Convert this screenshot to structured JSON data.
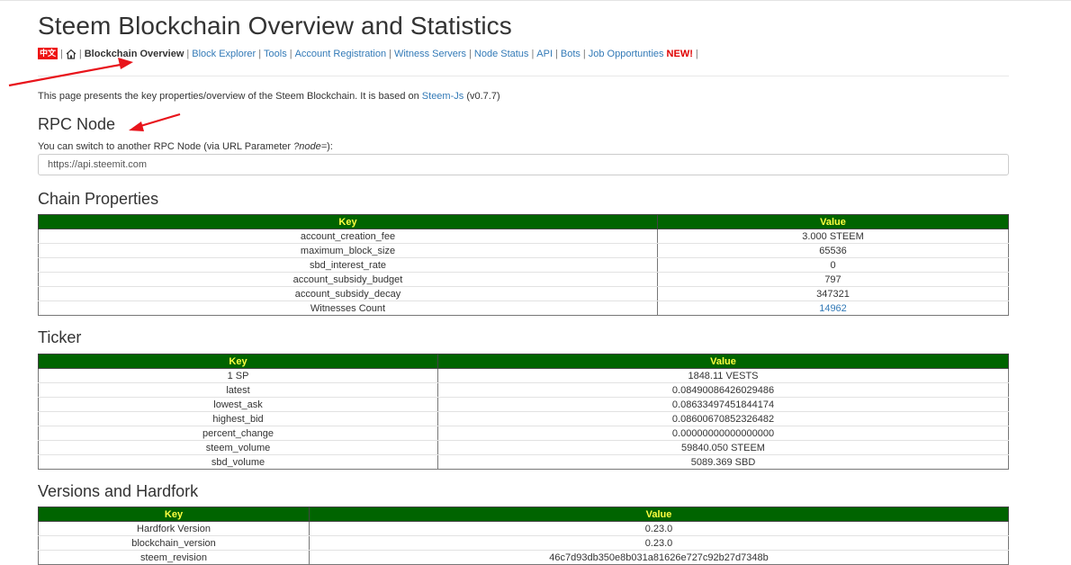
{
  "page": {
    "title": "Steem Blockchain Overview and Statistics"
  },
  "nav": {
    "lang_label": "中文",
    "home_icon": "home-icon",
    "items": [
      {
        "label": "Blockchain Overview",
        "current": true
      },
      {
        "label": "Block Explorer"
      },
      {
        "label": "Tools"
      },
      {
        "label": "Account Registration"
      },
      {
        "label": "Witness Servers"
      },
      {
        "label": "Node Status"
      },
      {
        "label": "API"
      },
      {
        "label": "Bots"
      },
      {
        "label": "Job Opportunties"
      }
    ],
    "new_badge": "NEW!"
  },
  "intro": {
    "text_before": "This page presents the key properties/overview of the Steem Blockchain. It is based on ",
    "link": "Steem-Js",
    "text_after": " (v0.7.7)"
  },
  "rpc": {
    "heading": "RPC Node",
    "hint_before": "You can switch to another RPC Node (via URL Parameter ",
    "hint_param": "?node=",
    "hint_after": "):",
    "value": "https://api.steemit.com"
  },
  "chain_properties": {
    "heading": "Chain Properties",
    "headers": [
      "Key",
      "Value"
    ],
    "rows": [
      [
        "account_creation_fee",
        "3.000 STEEM"
      ],
      [
        "maximum_block_size",
        "65536"
      ],
      [
        "sbd_interest_rate",
        "0"
      ],
      [
        "account_subsidy_budget",
        "797"
      ],
      [
        "account_subsidy_decay",
        "347321"
      ],
      [
        "Witnesses Count",
        "14962"
      ]
    ]
  },
  "ticker": {
    "heading": "Ticker",
    "headers": [
      "Key",
      "Value"
    ],
    "rows": [
      [
        "1 SP",
        "1848.11 VESTS"
      ],
      [
        "latest",
        "0.08490086426029486"
      ],
      [
        "lowest_ask",
        "0.08633497451844174"
      ],
      [
        "highest_bid",
        "0.08600670852326482"
      ],
      [
        "percent_change",
        "0.00000000000000000"
      ],
      [
        "steem_volume",
        "59840.050 STEEM"
      ],
      [
        "sbd_volume",
        "5089.369 SBD"
      ]
    ]
  },
  "versions": {
    "heading": "Versions and Hardfork",
    "headers": [
      "Key",
      "Value"
    ],
    "rows": [
      [
        "Hardfork Version",
        "0.23.0"
      ],
      [
        "blockchain_version",
        "0.23.0"
      ],
      [
        "steem_revision",
        "46c7d93db350e8b031a81626e727c92b27d7348b"
      ]
    ]
  },
  "colors": {
    "header_bg": "#006400",
    "header_text": "#ffff3f",
    "link": "#337ab7",
    "annotation_arrow": "#e8141b"
  }
}
